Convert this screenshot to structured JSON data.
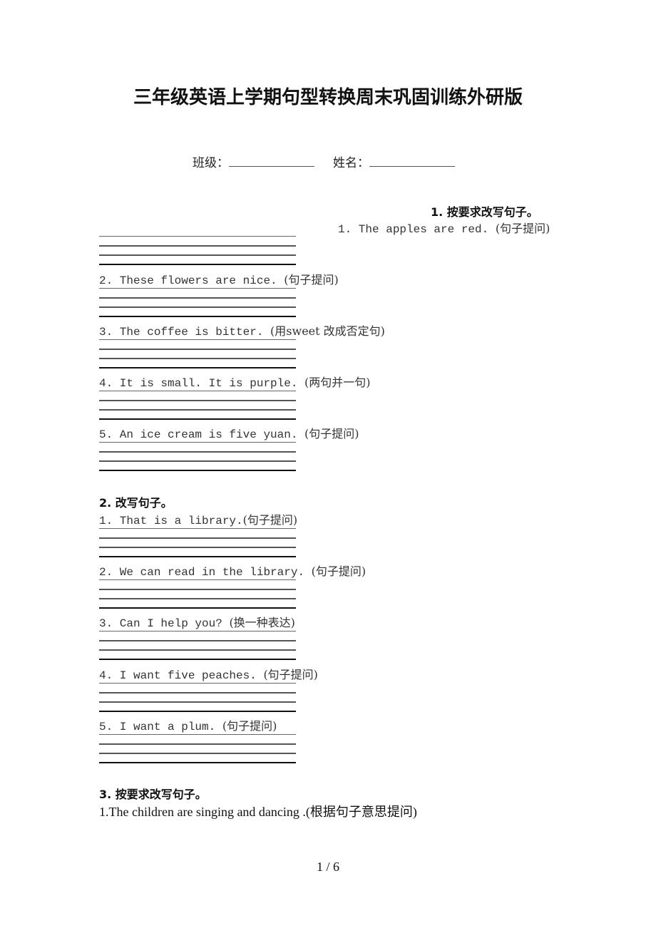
{
  "title": "三年级英语上学期句型转换周末巩固训练外研版",
  "info": {
    "class_label": "班级：",
    "name_label": "姓名："
  },
  "sections": [
    {
      "heading": "1. 按要求改写句子。",
      "questions": [
        {
          "text": "1. The apples are red. ",
          "hint": "(句子提问)"
        },
        {
          "text": "2. These flowers are nice. ",
          "hint": "(句子提问)"
        },
        {
          "text": "3. The coffee is bitter. ",
          "hint": "(用sweet 改成否定句)"
        },
        {
          "text": "4. It is small. It is purple. ",
          "hint": "(两句并一句)"
        },
        {
          "text": "5. An ice cream is five yuan. ",
          "hint": "(句子提问)"
        }
      ]
    },
    {
      "heading": "2. 改写句子。",
      "questions": [
        {
          "text": "1. That is a library.",
          "hint": "(句子提问)"
        },
        {
          "text": "2. We can read in the library. ",
          "hint": "(句子提问)"
        },
        {
          "text": "3. Can I help you? ",
          "hint": "(换一种表达)"
        },
        {
          "text": "4. I want five peaches. ",
          "hint": "(句子提问)"
        },
        {
          "text": "5. I want a plum. ",
          "hint": "(句子提问)"
        }
      ]
    },
    {
      "heading": "3. 按要求改写句子。",
      "questions": [
        {
          "text": "1.The children are singing and dancing .",
          "hint": "(根据句子意思提问)"
        }
      ]
    }
  ],
  "footer": {
    "page_indicator": "1 / 6"
  }
}
